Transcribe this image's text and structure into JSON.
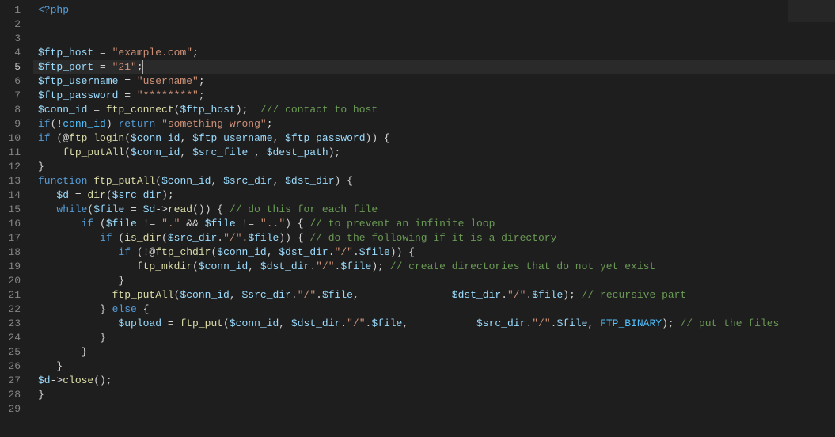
{
  "editor": {
    "activeLine": 5,
    "totalLines": 29,
    "lineNumbers": [
      "1",
      "2",
      "3",
      "4",
      "5",
      "6",
      "7",
      "8",
      "9",
      "10",
      "11",
      "12",
      "13",
      "14",
      "15",
      "16",
      "17",
      "18",
      "19",
      "20",
      "21",
      "22",
      "23",
      "24",
      "25",
      "26",
      "27",
      "28",
      "29"
    ],
    "cursor": {
      "line": 5,
      "afterText": ";"
    },
    "tokensByLine": {
      "1": [
        {
          "t": "<?php",
          "c": "tok-kw"
        }
      ],
      "2": [],
      "3": [],
      "4": [
        {
          "t": "$ftp_host",
          "c": "tok-var"
        },
        {
          "t": " = ",
          "c": "tok-op"
        },
        {
          "t": "\"example.com\"",
          "c": "tok-str"
        },
        {
          "t": ";",
          "c": "tok-pun"
        }
      ],
      "5": [
        {
          "t": "$ftp_port",
          "c": "tok-var"
        },
        {
          "t": " = ",
          "c": "tok-op"
        },
        {
          "t": "\"21\"",
          "c": "tok-str"
        },
        {
          "t": ";",
          "c": "tok-pun",
          "cursorAfter": true
        }
      ],
      "6": [
        {
          "t": "$ftp_username",
          "c": "tok-var"
        },
        {
          "t": " = ",
          "c": "tok-op"
        },
        {
          "t": "\"username\"",
          "c": "tok-str"
        },
        {
          "t": ";",
          "c": "tok-pun"
        }
      ],
      "7": [
        {
          "t": "$ftp_password",
          "c": "tok-var"
        },
        {
          "t": " = ",
          "c": "tok-op"
        },
        {
          "t": "\"********\"",
          "c": "tok-str"
        },
        {
          "t": ";",
          "c": "tok-pun"
        }
      ],
      "8": [
        {
          "t": "$conn_id",
          "c": "tok-var"
        },
        {
          "t": " = ",
          "c": "tok-op"
        },
        {
          "t": "ftp_connect",
          "c": "tok-fn"
        },
        {
          "t": "(",
          "c": "tok-pun"
        },
        {
          "t": "$ftp_host",
          "c": "tok-var"
        },
        {
          "t": ");  ",
          "c": "tok-pun"
        },
        {
          "t": "/// contact to host",
          "c": "tok-cmt"
        }
      ],
      "9": [
        {
          "t": "if",
          "c": "tok-kw"
        },
        {
          "t": "(!",
          "c": "tok-op"
        },
        {
          "t": "conn_id",
          "c": "tok-const"
        },
        {
          "t": ") ",
          "c": "tok-pun"
        },
        {
          "t": "return",
          "c": "tok-kw"
        },
        {
          "t": " ",
          "c": "tok-op"
        },
        {
          "t": "\"something wrong\"",
          "c": "tok-str"
        },
        {
          "t": ";",
          "c": "tok-pun"
        }
      ],
      "10": [
        {
          "t": "if",
          "c": "tok-kw"
        },
        {
          "t": " (@",
          "c": "tok-op"
        },
        {
          "t": "ftp_login",
          "c": "tok-fn"
        },
        {
          "t": "(",
          "c": "tok-pun"
        },
        {
          "t": "$conn_id",
          "c": "tok-var"
        },
        {
          "t": ", ",
          "c": "tok-pun"
        },
        {
          "t": "$ftp_username",
          "c": "tok-var"
        },
        {
          "t": ", ",
          "c": "tok-pun"
        },
        {
          "t": "$ftp_password",
          "c": "tok-var"
        },
        {
          "t": ")) {",
          "c": "tok-pun"
        }
      ],
      "11": [
        {
          "t": "    ",
          "c": "tok-op"
        },
        {
          "t": "ftp_putAll",
          "c": "tok-fn"
        },
        {
          "t": "(",
          "c": "tok-pun"
        },
        {
          "t": "$conn_id",
          "c": "tok-var"
        },
        {
          "t": ", ",
          "c": "tok-pun"
        },
        {
          "t": "$src_file",
          "c": "tok-var"
        },
        {
          "t": " , ",
          "c": "tok-pun"
        },
        {
          "t": "$dest_path",
          "c": "tok-var"
        },
        {
          "t": ");",
          "c": "tok-pun"
        }
      ],
      "12": [
        {
          "t": "}",
          "c": "tok-pun"
        }
      ],
      "13": [
        {
          "t": "function",
          "c": "tok-kw"
        },
        {
          "t": " ",
          "c": "tok-op"
        },
        {
          "t": "ftp_putAll",
          "c": "tok-fn"
        },
        {
          "t": "(",
          "c": "tok-pun"
        },
        {
          "t": "$conn_id",
          "c": "tok-var"
        },
        {
          "t": ", ",
          "c": "tok-pun"
        },
        {
          "t": "$src_dir",
          "c": "tok-var"
        },
        {
          "t": ", ",
          "c": "tok-pun"
        },
        {
          "t": "$dst_dir",
          "c": "tok-var"
        },
        {
          "t": ") {",
          "c": "tok-pun"
        }
      ],
      "14": [
        {
          "t": "   ",
          "c": "tok-op"
        },
        {
          "t": "$d",
          "c": "tok-var"
        },
        {
          "t": " = ",
          "c": "tok-op"
        },
        {
          "t": "dir",
          "c": "tok-fn"
        },
        {
          "t": "(",
          "c": "tok-pun"
        },
        {
          "t": "$src_dir",
          "c": "tok-var"
        },
        {
          "t": ");",
          "c": "tok-pun"
        }
      ],
      "15": [
        {
          "t": "   ",
          "c": "tok-op"
        },
        {
          "t": "while",
          "c": "tok-kw"
        },
        {
          "t": "(",
          "c": "tok-pun"
        },
        {
          "t": "$file",
          "c": "tok-var"
        },
        {
          "t": " = ",
          "c": "tok-op"
        },
        {
          "t": "$d",
          "c": "tok-var"
        },
        {
          "t": "->",
          "c": "tok-op"
        },
        {
          "t": "read",
          "c": "tok-fn"
        },
        {
          "t": "()) { ",
          "c": "tok-pun"
        },
        {
          "t": "// do this for each file",
          "c": "tok-cmt"
        }
      ],
      "16": [
        {
          "t": "       ",
          "c": "tok-op"
        },
        {
          "t": "if",
          "c": "tok-kw"
        },
        {
          "t": " (",
          "c": "tok-pun"
        },
        {
          "t": "$file",
          "c": "tok-var"
        },
        {
          "t": " != ",
          "c": "tok-op"
        },
        {
          "t": "\".\"",
          "c": "tok-str"
        },
        {
          "t": " && ",
          "c": "tok-op"
        },
        {
          "t": "$file",
          "c": "tok-var"
        },
        {
          "t": " != ",
          "c": "tok-op"
        },
        {
          "t": "\"..\"",
          "c": "tok-str"
        },
        {
          "t": ") { ",
          "c": "tok-pun"
        },
        {
          "t": "// to prevent an infinite loop",
          "c": "tok-cmt"
        }
      ],
      "17": [
        {
          "t": "          ",
          "c": "tok-op"
        },
        {
          "t": "if",
          "c": "tok-kw"
        },
        {
          "t": " (",
          "c": "tok-pun"
        },
        {
          "t": "is_dir",
          "c": "tok-fn"
        },
        {
          "t": "(",
          "c": "tok-pun"
        },
        {
          "t": "$src_dir",
          "c": "tok-var"
        },
        {
          "t": ".",
          "c": "tok-op"
        },
        {
          "t": "\"/\"",
          "c": "tok-str"
        },
        {
          "t": ".",
          "c": "tok-op"
        },
        {
          "t": "$file",
          "c": "tok-var"
        },
        {
          "t": ")) { ",
          "c": "tok-pun"
        },
        {
          "t": "// do the following if it is a directory",
          "c": "tok-cmt"
        }
      ],
      "18": [
        {
          "t": "             ",
          "c": "tok-op"
        },
        {
          "t": "if",
          "c": "tok-kw"
        },
        {
          "t": " (!@",
          "c": "tok-op"
        },
        {
          "t": "ftp_chdir",
          "c": "tok-fn"
        },
        {
          "t": "(",
          "c": "tok-pun"
        },
        {
          "t": "$conn_id",
          "c": "tok-var"
        },
        {
          "t": ", ",
          "c": "tok-pun"
        },
        {
          "t": "$dst_dir",
          "c": "tok-var"
        },
        {
          "t": ".",
          "c": "tok-op"
        },
        {
          "t": "\"/\"",
          "c": "tok-str"
        },
        {
          "t": ".",
          "c": "tok-op"
        },
        {
          "t": "$file",
          "c": "tok-var"
        },
        {
          "t": ")) {",
          "c": "tok-pun"
        }
      ],
      "19": [
        {
          "t": "                ",
          "c": "tok-op"
        },
        {
          "t": "ftp_mkdir",
          "c": "tok-fn"
        },
        {
          "t": "(",
          "c": "tok-pun"
        },
        {
          "t": "$conn_id",
          "c": "tok-var"
        },
        {
          "t": ", ",
          "c": "tok-pun"
        },
        {
          "t": "$dst_dir",
          "c": "tok-var"
        },
        {
          "t": ".",
          "c": "tok-op"
        },
        {
          "t": "\"/\"",
          "c": "tok-str"
        },
        {
          "t": ".",
          "c": "tok-op"
        },
        {
          "t": "$file",
          "c": "tok-var"
        },
        {
          "t": "); ",
          "c": "tok-pun"
        },
        {
          "t": "// create directories that do not yet exist",
          "c": "tok-cmt"
        }
      ],
      "20": [
        {
          "t": "             }",
          "c": "tok-pun"
        }
      ],
      "21": [
        {
          "t": "            ",
          "c": "tok-op"
        },
        {
          "t": "ftp_putAll",
          "c": "tok-fn"
        },
        {
          "t": "(",
          "c": "tok-pun"
        },
        {
          "t": "$conn_id",
          "c": "tok-var"
        },
        {
          "t": ", ",
          "c": "tok-pun"
        },
        {
          "t": "$src_dir",
          "c": "tok-var"
        },
        {
          "t": ".",
          "c": "tok-op"
        },
        {
          "t": "\"/\"",
          "c": "tok-str"
        },
        {
          "t": ".",
          "c": "tok-op"
        },
        {
          "t": "$file",
          "c": "tok-var"
        },
        {
          "t": ",               ",
          "c": "tok-pun"
        },
        {
          "t": "$dst_dir",
          "c": "tok-var"
        },
        {
          "t": ".",
          "c": "tok-op"
        },
        {
          "t": "\"/\"",
          "c": "tok-str"
        },
        {
          "t": ".",
          "c": "tok-op"
        },
        {
          "t": "$file",
          "c": "tok-var"
        },
        {
          "t": "); ",
          "c": "tok-pun"
        },
        {
          "t": "// recursive part",
          "c": "tok-cmt"
        }
      ],
      "22": [
        {
          "t": "          } ",
          "c": "tok-pun"
        },
        {
          "t": "else",
          "c": "tok-kw"
        },
        {
          "t": " {",
          "c": "tok-pun"
        }
      ],
      "23": [
        {
          "t": "             ",
          "c": "tok-op"
        },
        {
          "t": "$upload",
          "c": "tok-var"
        },
        {
          "t": " = ",
          "c": "tok-op"
        },
        {
          "t": "ftp_put",
          "c": "tok-fn"
        },
        {
          "t": "(",
          "c": "tok-pun"
        },
        {
          "t": "$conn_id",
          "c": "tok-var"
        },
        {
          "t": ", ",
          "c": "tok-pun"
        },
        {
          "t": "$dst_dir",
          "c": "tok-var"
        },
        {
          "t": ".",
          "c": "tok-op"
        },
        {
          "t": "\"/\"",
          "c": "tok-str"
        },
        {
          "t": ".",
          "c": "tok-op"
        },
        {
          "t": "$file",
          "c": "tok-var"
        },
        {
          "t": ",           ",
          "c": "tok-pun"
        },
        {
          "t": "$src_dir",
          "c": "tok-var"
        },
        {
          "t": ".",
          "c": "tok-op"
        },
        {
          "t": "\"/\"",
          "c": "tok-str"
        },
        {
          "t": ".",
          "c": "tok-op"
        },
        {
          "t": "$file",
          "c": "tok-var"
        },
        {
          "t": ", ",
          "c": "tok-pun"
        },
        {
          "t": "FTP_BINARY",
          "c": "tok-const"
        },
        {
          "t": "); ",
          "c": "tok-pun"
        },
        {
          "t": "// put the files",
          "c": "tok-cmt"
        }
      ],
      "24": [
        {
          "t": "          }",
          "c": "tok-pun"
        }
      ],
      "25": [
        {
          "t": "       }",
          "c": "tok-pun"
        }
      ],
      "26": [
        {
          "t": "   }",
          "c": "tok-pun"
        }
      ],
      "27": [
        {
          "t": "$d",
          "c": "tok-var"
        },
        {
          "t": "->",
          "c": "tok-op"
        },
        {
          "t": "close",
          "c": "tok-fn"
        },
        {
          "t": "();",
          "c": "tok-pun"
        }
      ],
      "28": [
        {
          "t": "}",
          "c": "tok-pun"
        }
      ],
      "29": []
    }
  }
}
